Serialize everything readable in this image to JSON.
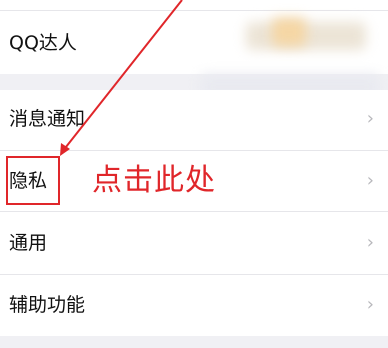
{
  "settings": {
    "items": [
      {
        "label": "QQ达人",
        "chevron": false
      },
      {
        "label": "消息通知",
        "chevron": true
      },
      {
        "label": "隐私",
        "chevron": true
      },
      {
        "label": "通用",
        "chevron": true
      },
      {
        "label": "辅助功能",
        "chevron": true
      }
    ]
  },
  "annotation": {
    "text": "点击此处",
    "color": "#e0262a"
  },
  "icons": {
    "chevron": "chevron-right-icon"
  },
  "colors": {
    "background": "#f0f0f4",
    "row": "#ffffff",
    "highlight": "#e0262a"
  }
}
